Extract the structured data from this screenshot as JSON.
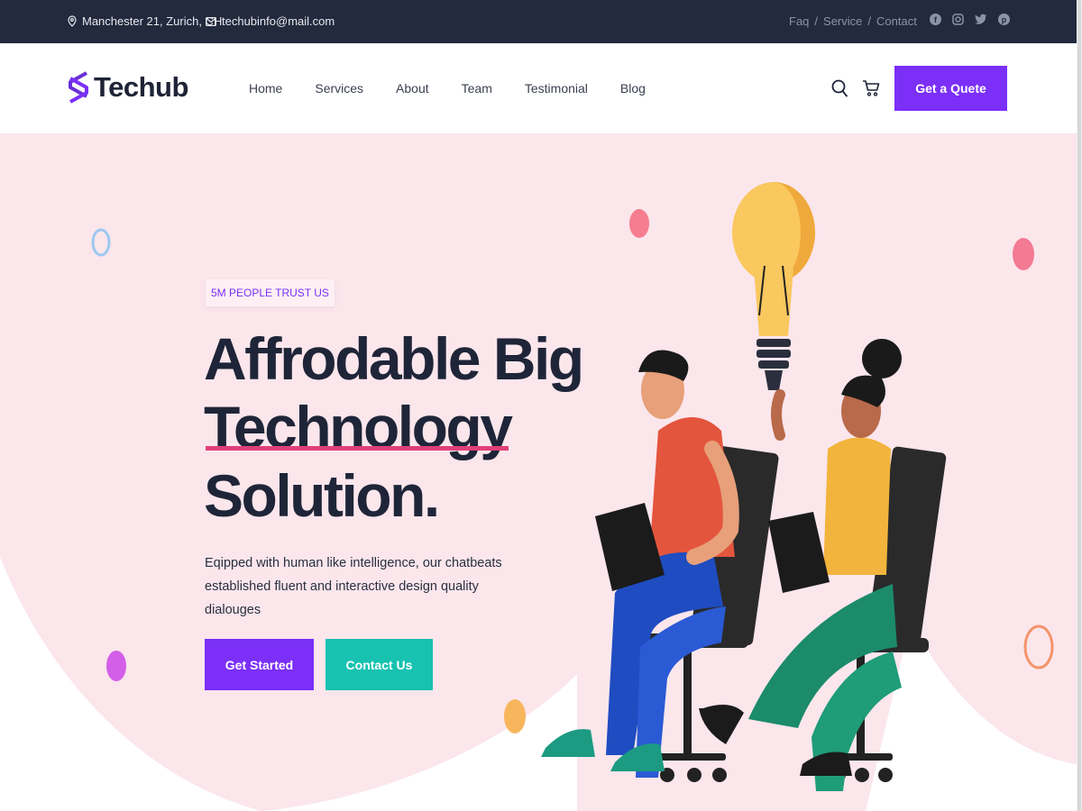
{
  "topbar": {
    "address": "Manchester 21, Zurich, CH",
    "email": "techubinfo@mail.com",
    "links": [
      "Faq",
      "Service",
      "Contact"
    ],
    "separator": "/",
    "socials": [
      "facebook-icon",
      "instagram-icon",
      "twitter-icon",
      "pinterest-icon"
    ]
  },
  "header": {
    "logo": "Techub",
    "nav": [
      "Home",
      "Services",
      "About",
      "Team",
      "Testimonial",
      "Blog"
    ],
    "quote_button": "Get a Quete"
  },
  "hero": {
    "badge": "5M PEOPLE TRUST US",
    "headline_1": "Affrodable Big",
    "headline_2": "Technology",
    "headline_3": "Solution.",
    "description": "Eqipped with human like intelligence, our chatbeats established fluent and interactive design quality dialouges",
    "primary_button": "Get Started",
    "secondary_button": "Contact Us"
  },
  "colors": {
    "topbar": "#232a3d",
    "accent_purple": "#7b2ff7",
    "accent_teal": "#17c2b0",
    "hero_bg": "#fbe6ec",
    "underline_pink": "#e0407a"
  }
}
